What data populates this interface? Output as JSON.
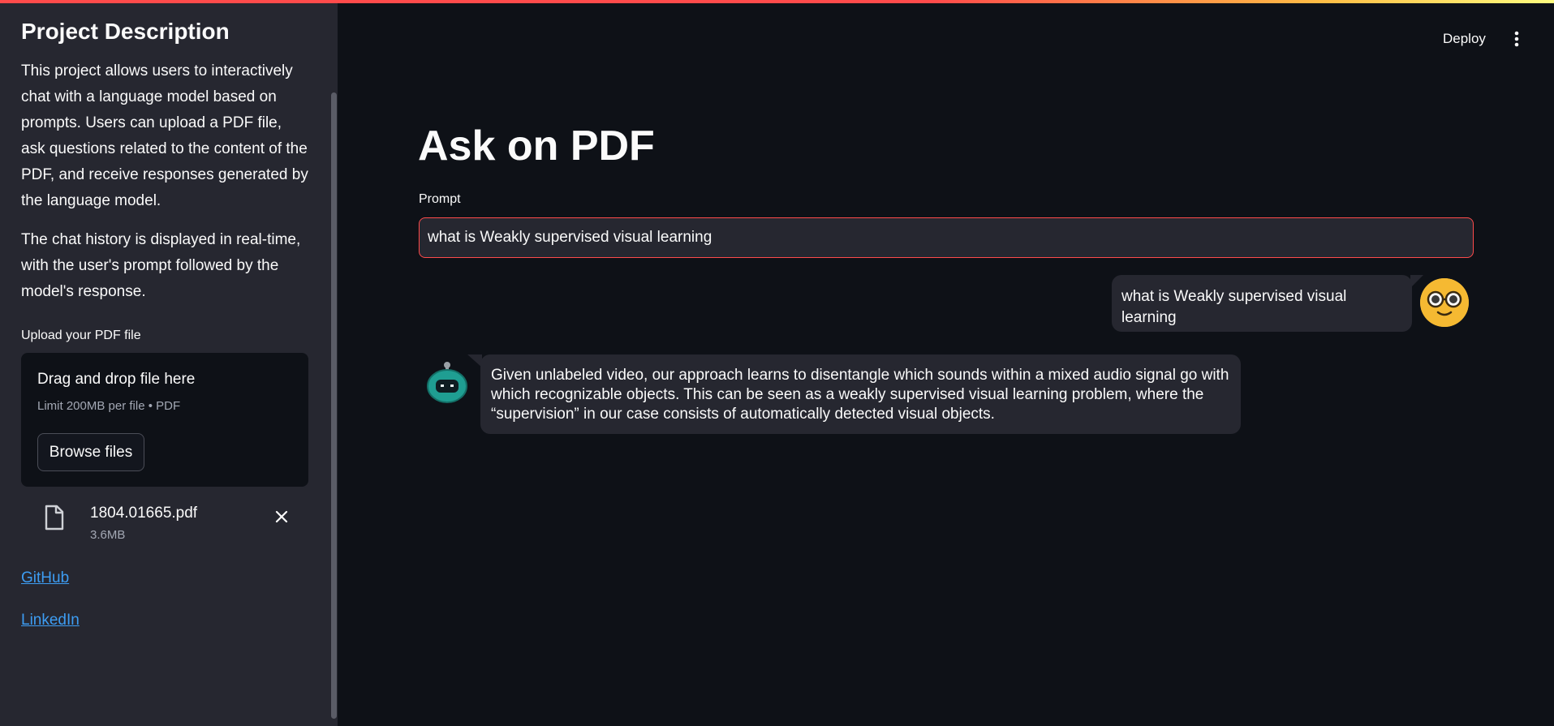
{
  "sidebar": {
    "title": "Project Description",
    "paragraph_1": "This project allows users to interactively chat with a language model based on prompts. Users can upload a PDF file, ask questions related to the content of the PDF, and receive responses generated by the language model.",
    "paragraph_2": "The chat history is displayed in real-time, with the user's prompt followed by the model's response.",
    "upload_label": "Upload your PDF file",
    "dropzone": {
      "title": "Drag and drop file here",
      "limit": "Limit 200MB per file • PDF",
      "browse_label": "Browse files"
    },
    "uploaded_file": {
      "name": "1804.01665.pdf",
      "size": "3.6MB",
      "icon": "file-icon",
      "remove_icon": "close-icon"
    },
    "links": {
      "github": "GitHub",
      "linkedin": "LinkedIn"
    }
  },
  "header": {
    "deploy_label": "Deploy",
    "menu_icon": "more-vertical-icon"
  },
  "main": {
    "title": "Ask on PDF",
    "prompt_label": "Prompt",
    "prompt_value": "what is Weakly supervised visual learning",
    "messages": [
      {
        "role": "user",
        "text": "what is Weakly supervised visual learning",
        "avatar": "nerd-face-avatar"
      },
      {
        "role": "assistant",
        "text": "Given unlabeled video, our approach learns to disentangle which sounds within a mixed audio signal go with which recognizable objects. This can be seen as a weakly supervised visual learning problem, where the “supervision” in our case consists of automatically detected visual objects.",
        "avatar": "robot-avatar"
      }
    ]
  },
  "colors": {
    "background": "#0e1117",
    "sidebar": "#262730",
    "accent": "#ff4b4b",
    "link": "#3d9df3",
    "user_avatar": "#f5b932"
  }
}
